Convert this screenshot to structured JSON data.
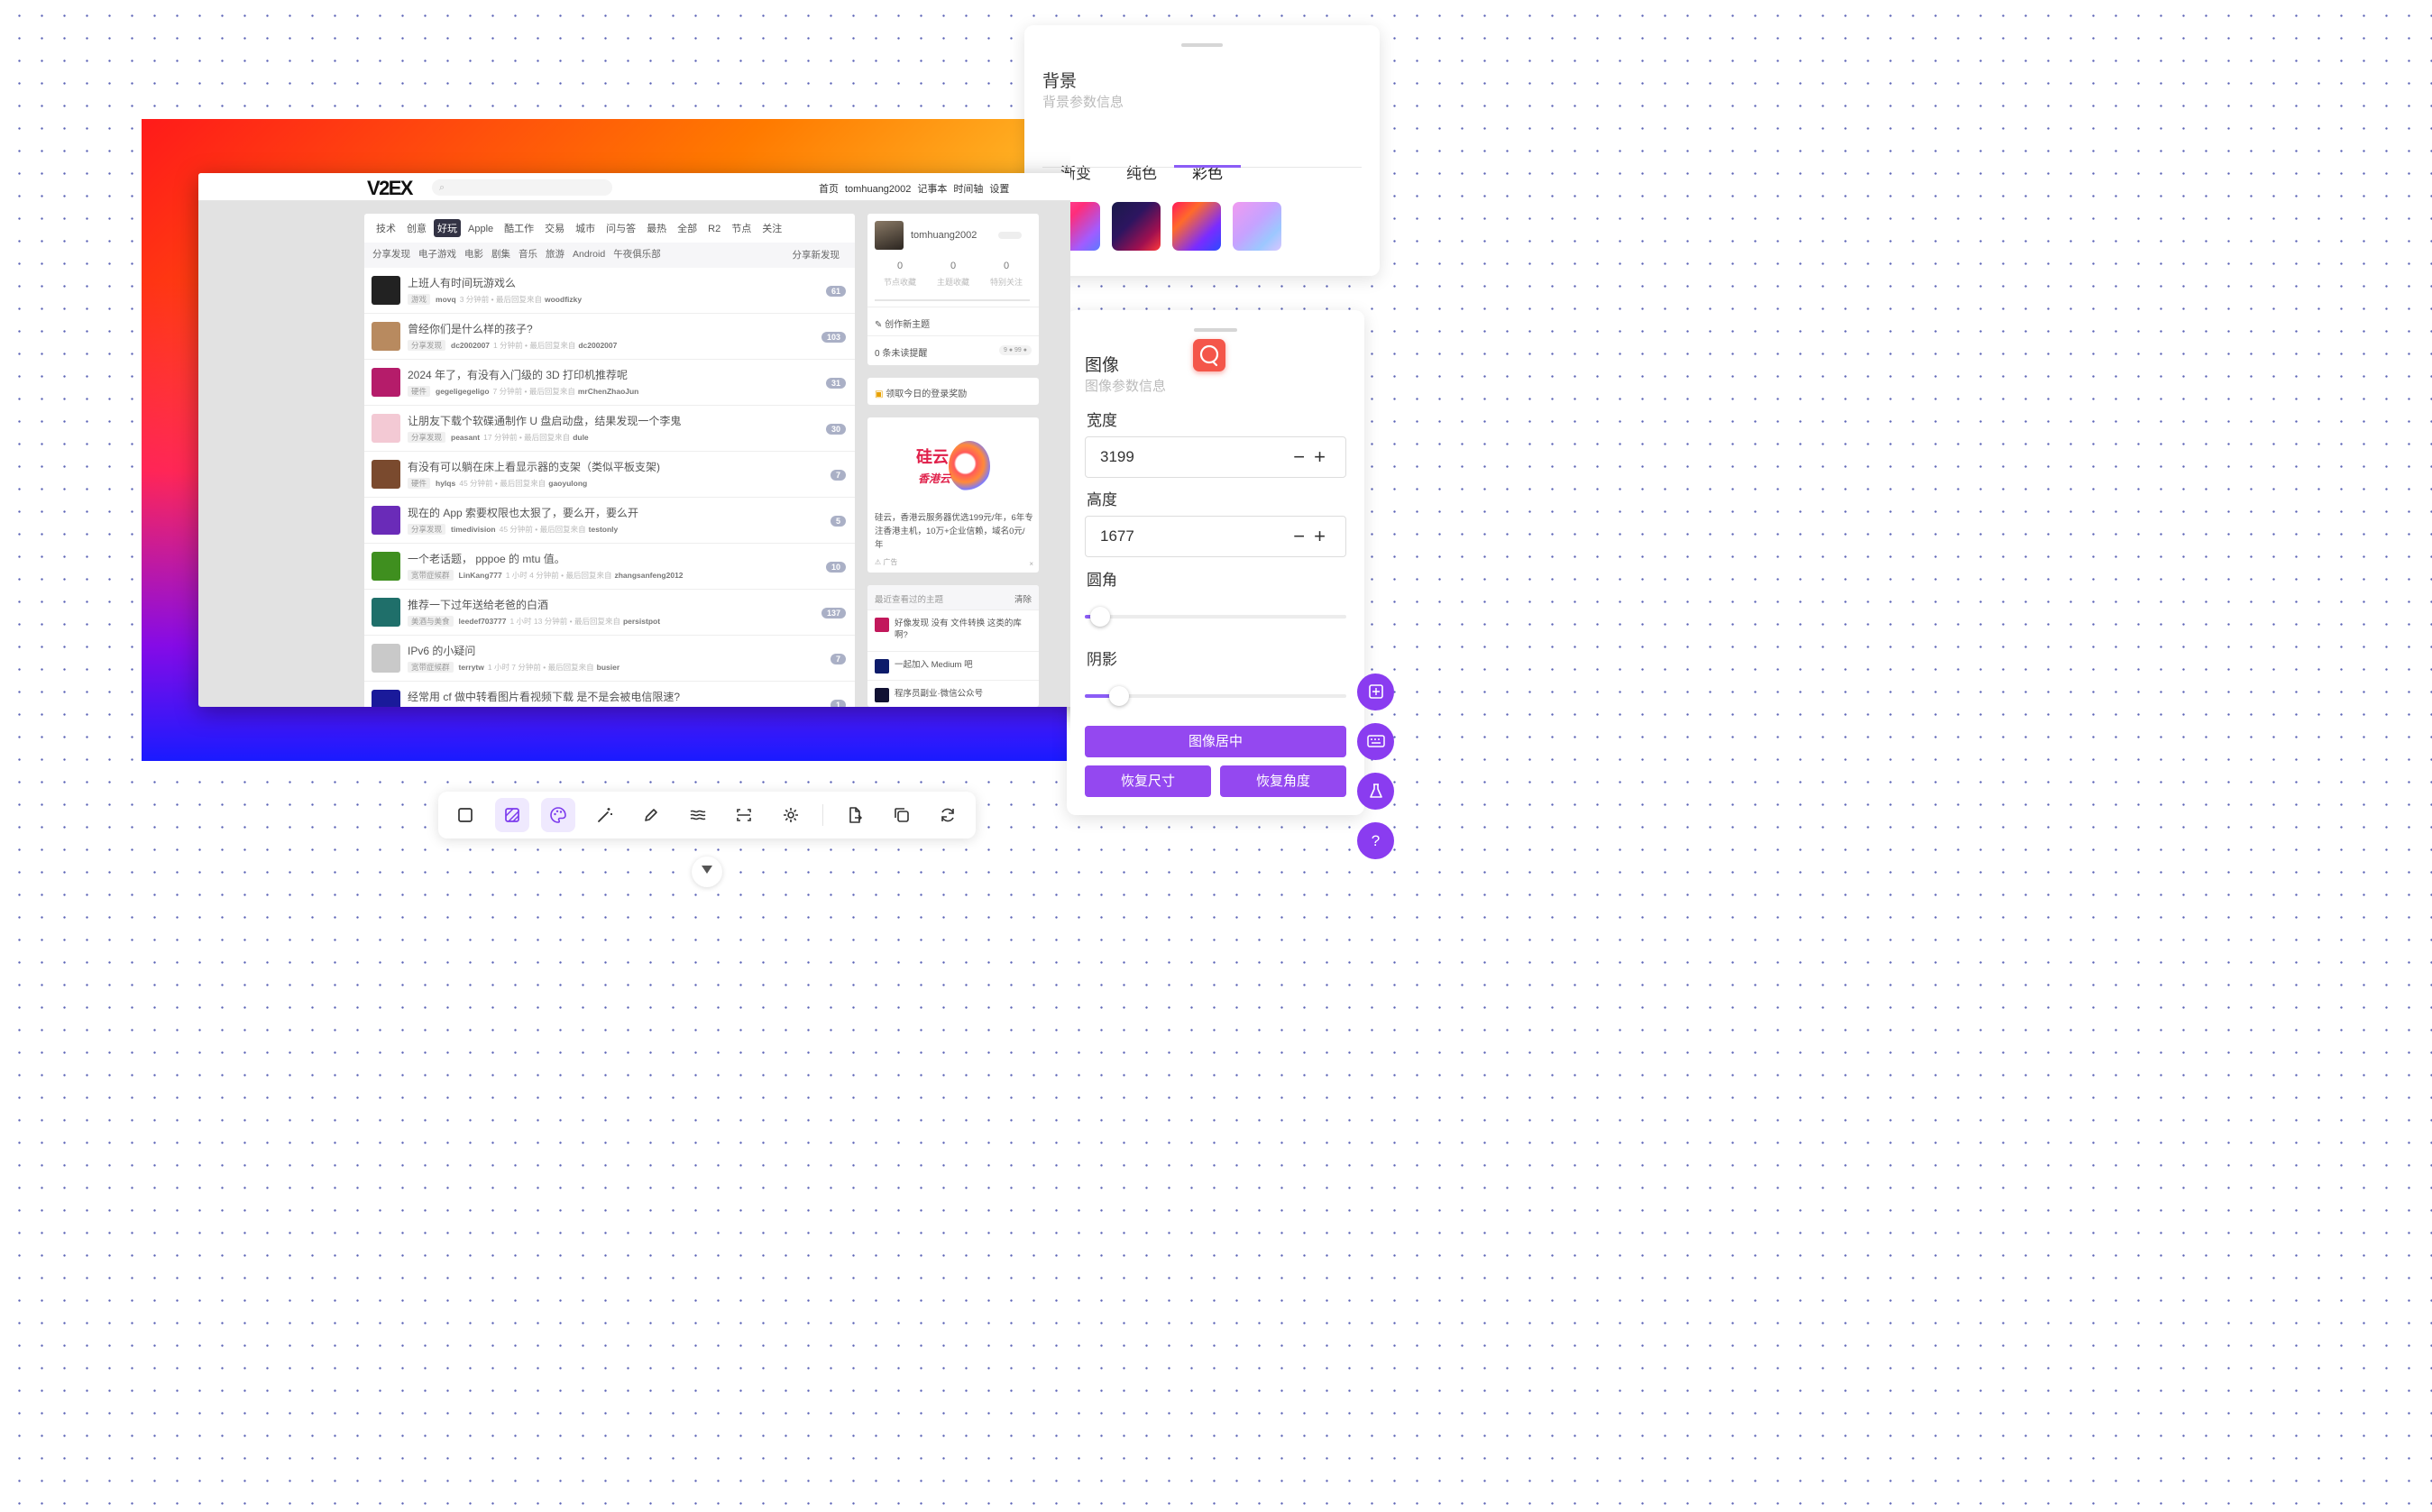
{
  "v2ex": {
    "logo": "V2EX",
    "nav": [
      "首页",
      "tomhuang2002",
      "记事本",
      "时间轴",
      "设置"
    ],
    "tabs": [
      "技术",
      "创意",
      "好玩",
      "Apple",
      "酷工作",
      "交易",
      "城市",
      "问与答",
      "最热",
      "全部",
      "R2",
      "节点",
      "关注"
    ],
    "active_tab": "好玩",
    "subtabs": [
      "分享发现",
      "电子游戏",
      "电影",
      "剧集",
      "音乐",
      "旅游",
      "Android",
      "午夜俱乐部"
    ],
    "subtabs_right": "分享新发现",
    "topics": [
      {
        "title": "上班人有时间玩游戏么",
        "node": "游戏",
        "user": "movq",
        "time": "3 分钟前",
        "last_label": "最后回复来自",
        "last_user": "woodfizky",
        "count": "61",
        "avatar_color": "#222"
      },
      {
        "title": "曾经你们是什么样的孩子?",
        "node": "分享发现",
        "user": "dc2002007",
        "time": "1 分钟前",
        "last_label": "最后回复来自",
        "last_user": "dc2002007",
        "count": "103",
        "avatar_color": "#b88a5f"
      },
      {
        "title": "2024 年了，有没有入门级的 3D 打印机推荐呢",
        "node": "硬件",
        "user": "gegeligegeligo",
        "time": "7 分钟前",
        "last_label": "最后回复来自",
        "last_user": "mrChenZhaoJun",
        "count": "31",
        "avatar_color": "#b51c6a"
      },
      {
        "title": "让朋友下载个软碟通制作 U 盘启动盘，结果发现一个李鬼",
        "node": "分享发现",
        "user": "peasant",
        "time": "17 分钟前",
        "last_label": "最后回复来自",
        "last_user": "dule",
        "count": "30",
        "avatar_color": "#f3c9d4"
      },
      {
        "title": "有没有可以躺在床上看显示器的支架（类似平板支架)",
        "node": "硬件",
        "user": "hylqs",
        "time": "45 分钟前",
        "last_label": "最后回复来自",
        "last_user": "gaoyulong",
        "count": "7",
        "avatar_color": "#7a4a2e"
      },
      {
        "title": "现在的 App 索要权限也太狠了，要么开，要么开",
        "node": "分享发现",
        "user": "timedivision",
        "time": "45 分钟前",
        "last_label": "最后回复来自",
        "last_user": "testonly",
        "count": "5",
        "avatar_color": "#6a2bb8"
      },
      {
        "title": "一个老话题， pppoe 的 mtu 值。",
        "node": "宽带症候群",
        "user": "LinKang777",
        "time": "1 小时 4 分钟前",
        "last_label": "最后回复来自",
        "last_user": "zhangsanfeng2012",
        "count": "10",
        "avatar_color": "#3f8f1f"
      },
      {
        "title": "推荐一下过年送给老爸的白酒",
        "node": "美酒与美食",
        "user": "leedef703777",
        "time": "1 小时 13 分钟前",
        "last_label": "最后回复来自",
        "last_user": "persistpot",
        "count": "137",
        "avatar_color": "#1f6f6a"
      },
      {
        "title": "IPv6 的小疑问",
        "node": "宽带症候群",
        "user": "terrytw",
        "time": "1 小时 7 分钟前",
        "last_label": "最后回复来自",
        "last_user": "busier",
        "count": "7",
        "avatar_color": "#c9c9c9"
      },
      {
        "title": "经常用 cf 做中转看图片看视频下载 是不是会被电信限速?",
        "node": "",
        "user": "",
        "time": "",
        "last_label": "",
        "last_user": "",
        "count": "1",
        "avatar_color": "#1a1a9a"
      }
    ],
    "profile": {
      "name": "tomhuang2002",
      "stats": [
        {
          "n": "0",
          "l": "节点收藏"
        },
        {
          "n": "0",
          "l": "主题收藏"
        },
        {
          "n": "0",
          "l": "特别关注"
        }
      ],
      "create": "创作新主题",
      "unread": "0 条未读提醒",
      "unread_badge": "9 ● 99 ●"
    },
    "reward": "领取今日的登录奖励",
    "ad": {
      "logo_line1": "硅云",
      "logo_line2": "香港云",
      "text": "硅云，香港云服务器优选199元/年，6年专注香港主机，10万+企业信赖，域名0元/年",
      "tag": "广告",
      "close": "×"
    },
    "recent": {
      "title": "最近查看过的主题",
      "clear": "清除",
      "items": [
        "好像发现 没有 文件转换 这类的库 啊?",
        "一起加入 Medium 吧",
        "程序员副业·微信公众号"
      ]
    }
  },
  "bg_panel": {
    "title": "背景",
    "subtitle": "背景参数信息",
    "tabs": [
      "渐变",
      "纯色",
      "彩色"
    ],
    "active_tab": "彩色",
    "swatches": [
      "linear-gradient(135deg,#ff4fa0,#ff2d7a 35%,#a15cff 75%,#5a7bff)",
      "linear-gradient(135deg,#1a1a4a,#2d1560 40%,#a01050 75%,#ff3a3a)",
      "linear-gradient(135deg,#ff1a5a,#ff6a2a 30%,#7a2cff 70%,#2a4aff)",
      "linear-gradient(135deg,#f19bf0,#c6a2ff 45%,#9cc7ff 75%,#d9c6ff)"
    ]
  },
  "img_panel": {
    "title": "图像",
    "subtitle": "图像参数信息",
    "width_label": "宽度",
    "width": "3199",
    "height_label": "高度",
    "height": "1677",
    "radius_label": "圆角",
    "shadow_label": "阴影",
    "radius_value": 0.06,
    "shadow_value": 0.13,
    "center_button": "图像居中",
    "reset_size_button": "恢复尺寸",
    "reset_angle_button": "恢复角度",
    "minus": "−",
    "plus": "+"
  },
  "help": "?",
  "accent": "#9448f0"
}
